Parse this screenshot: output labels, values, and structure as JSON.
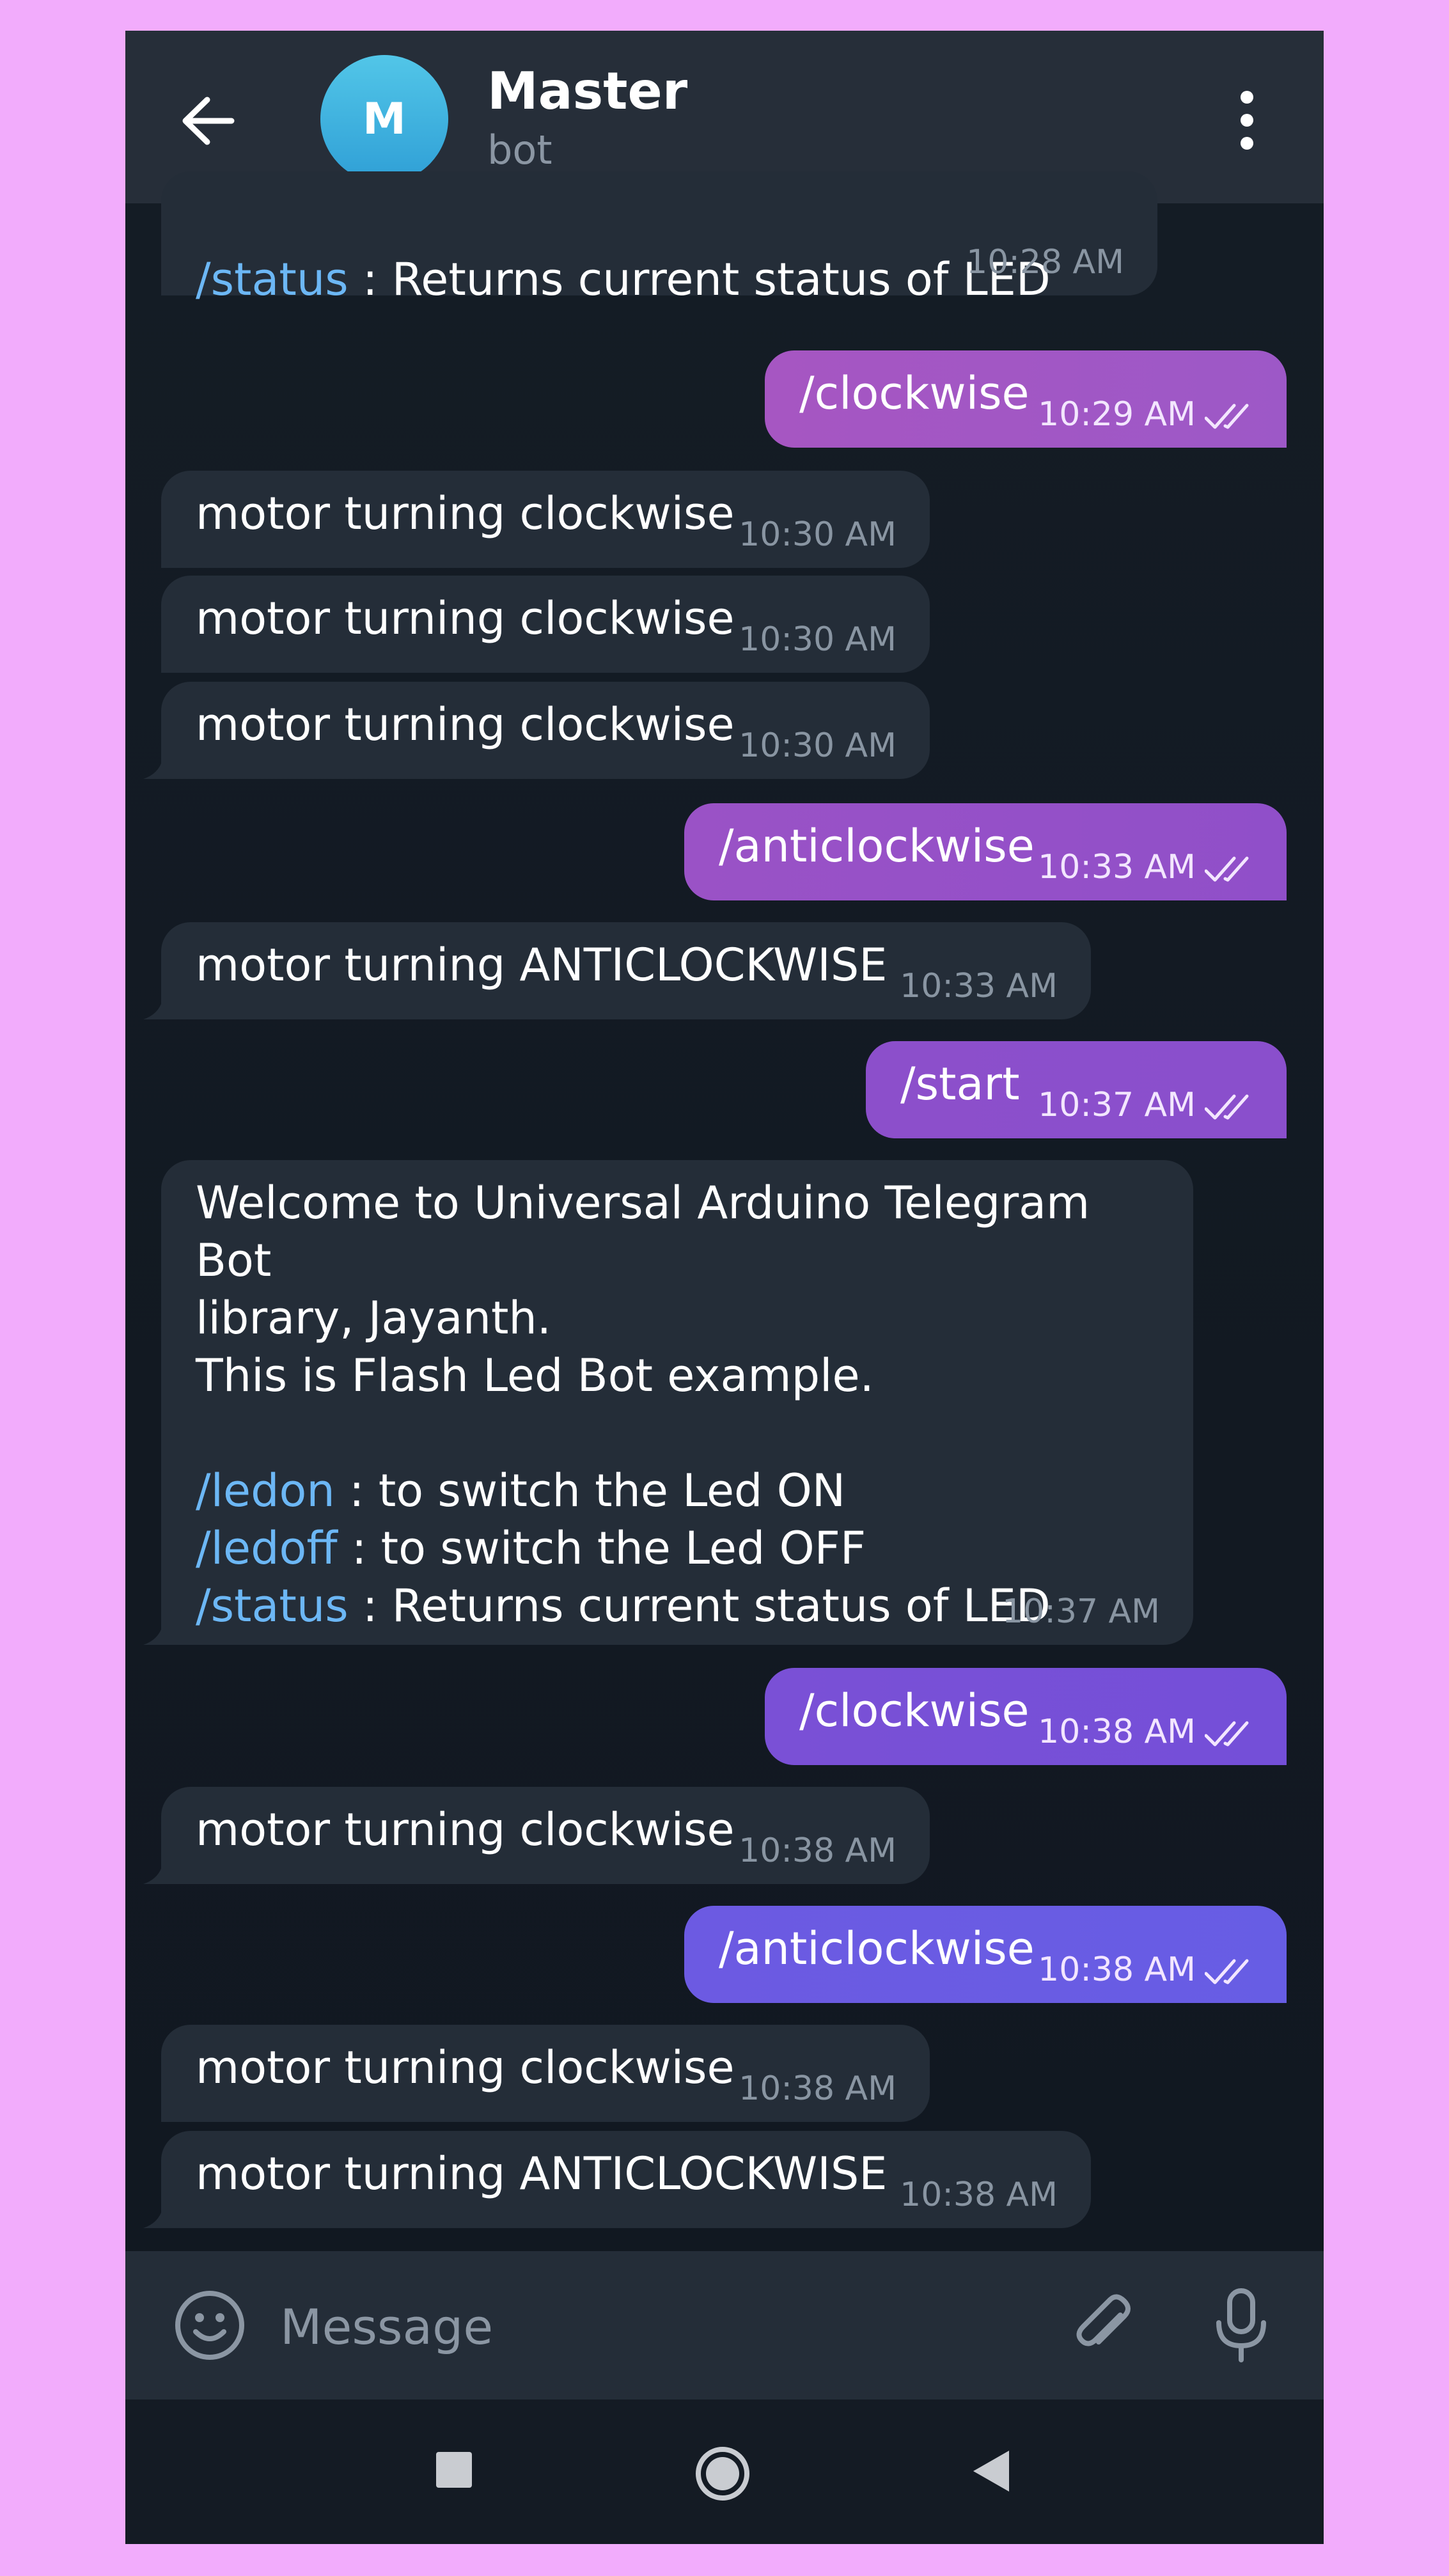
{
  "header": {
    "avatar_letter": "M",
    "title": "Master",
    "subtitle": "bot"
  },
  "messages": [
    {
      "dir": "in",
      "cmd": "/status",
      "rest": " : Returns current status of LED",
      "time": "10:28 AM"
    },
    {
      "dir": "out",
      "text": "/clockwise",
      "time": "10:29 AM",
      "read": true
    },
    {
      "dir": "in",
      "text": "motor turning clockwise",
      "time": "10:30 AM"
    },
    {
      "dir": "in",
      "text": "motor turning clockwise",
      "time": "10:30 AM"
    },
    {
      "dir": "in",
      "text": "motor turning clockwise",
      "time": "10:30 AM"
    },
    {
      "dir": "out",
      "text": "/anticlockwise",
      "time": "10:33 AM",
      "read": true
    },
    {
      "dir": "in",
      "text": "motor turning ANTICLOCKWISE",
      "time": "10:33 AM"
    },
    {
      "dir": "out",
      "text": "/start",
      "time": "10:37 AM",
      "read": true
    },
    {
      "dir": "in",
      "line1": "Welcome to Universal Arduino Telegram Bot",
      "line2": "library, Jayanth.",
      "line3": "This is Flash Led Bot example.",
      "cmd_ledon": "/ledon",
      "rest_ledon": " : to switch the Led ON",
      "cmd_ledoff": "/ledoff",
      "rest_ledoff": " : to switch the Led OFF",
      "cmd_status": "/status",
      "rest_status": " : Returns current status of LED",
      "time": "10:37 AM"
    },
    {
      "dir": "out",
      "text": "/clockwise",
      "time": "10:38 AM",
      "read": true
    },
    {
      "dir": "in",
      "text": "motor turning clockwise",
      "time": "10:38 AM"
    },
    {
      "dir": "out",
      "text": "/anticlockwise",
      "time": "10:38 AM",
      "read": true
    },
    {
      "dir": "in",
      "text": "motor turning clockwise",
      "time": "10:38 AM"
    },
    {
      "dir": "in",
      "text": "motor turning ANTICLOCKWISE",
      "time": "10:38 AM"
    }
  ],
  "input": {
    "placeholder": "Message"
  },
  "icons": {
    "back": "arrow-left-icon",
    "menu": "more-vertical-icon",
    "emoji": "smile-icon",
    "attach": "paperclip-icon",
    "mic": "microphone-icon",
    "nav_recents": "square-icon",
    "nav_home": "circle-icon",
    "nav_back": "triangle-left-icon",
    "read_receipt": "double-check-icon"
  },
  "colors": {
    "page_background": "#f2acfc",
    "outgoing_top": "#a157c4",
    "outgoing_bottom": "#6b5ee3",
    "incoming": "#242d38",
    "command_link": "#6cb7f5"
  }
}
